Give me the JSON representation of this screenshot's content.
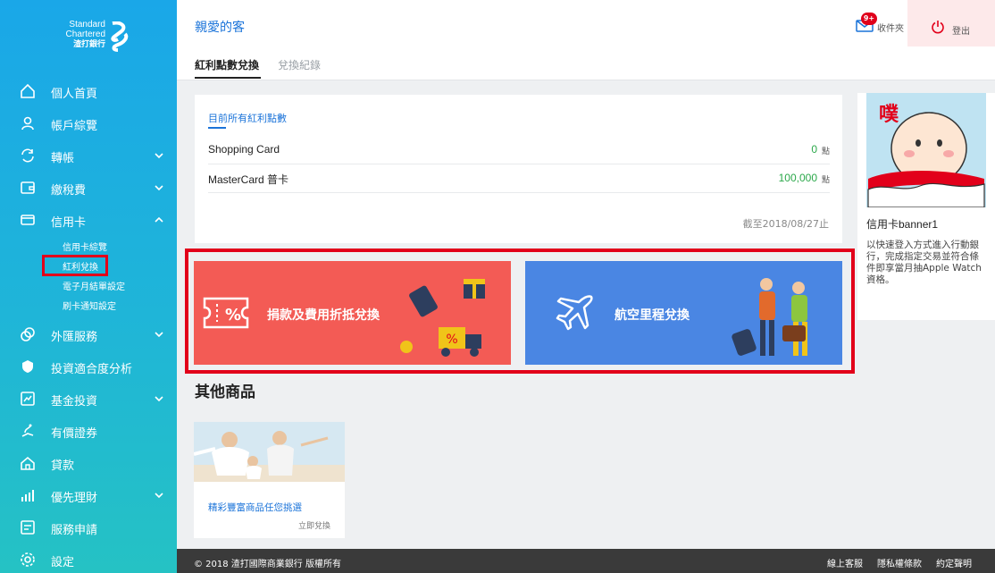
{
  "brand": {
    "line1": "Standard",
    "line2": "Chartered",
    "line3": "渣打銀行"
  },
  "sidebar": {
    "items": [
      {
        "label": "個人首頁",
        "icon": "home-icon"
      },
      {
        "label": "帳戶綜覽",
        "icon": "user-icon"
      },
      {
        "label": "轉帳",
        "icon": "transfer-icon",
        "chevron": "down"
      },
      {
        "label": "繳稅費",
        "icon": "wallet-icon",
        "chevron": "down"
      },
      {
        "label": "信用卡",
        "icon": "credit-card-icon",
        "chevron": "up"
      },
      {
        "label": "外匯服務",
        "icon": "currency-icon",
        "chevron": "down"
      },
      {
        "label": "投資適合度分析",
        "icon": "shield-icon"
      },
      {
        "label": "基金投資",
        "icon": "chart-icon",
        "chevron": "down"
      },
      {
        "label": "有價證券",
        "icon": "securities-icon"
      },
      {
        "label": "貸款",
        "icon": "loan-house-icon"
      },
      {
        "label": "優先理財",
        "icon": "bar-chart-icon",
        "chevron": "down"
      },
      {
        "label": "服務申請",
        "icon": "form-icon"
      },
      {
        "label": "設定",
        "icon": "gear-icon"
      }
    ],
    "credit_sub": [
      "信用卡綜覽",
      "紅利兌換",
      "電子月結單設定",
      "刷卡通知設定"
    ],
    "highlight_color": "#e2001a"
  },
  "header": {
    "greeting": "親愛的客",
    "inbox_label": "收件夾",
    "inbox_badge": "9+",
    "logout_label": "登出"
  },
  "tabs": [
    {
      "label": "紅利點數兌換",
      "active": true
    },
    {
      "label": "兌換紀錄",
      "active": false
    }
  ],
  "points": {
    "title": "目前所有紅利點數",
    "rows": [
      {
        "name": "Shopping Card",
        "value": "0",
        "unit": "點"
      },
      {
        "name": "MasterCard 普卡",
        "value": "100,000",
        "unit": "點"
      }
    ],
    "as_of": "截至2018/08/27止"
  },
  "banners": [
    {
      "label": "捐款及費用折抵兌換",
      "color": "#f35b55",
      "icon": "coupon-icon"
    },
    {
      "label": "航空里程兌換",
      "color": "#4a86e3",
      "icon": "airplane-icon"
    }
  ],
  "promo": {
    "title": "信用卡banner1",
    "desc": "以快速登入方式進入行動銀行，完成指定交易並符合條件即享當月抽Apple Watch資格。",
    "image_text": "噗"
  },
  "other": {
    "heading": "其他商品",
    "product_title": "精彩豐富商品任您挑選",
    "product_link": "立即兌換"
  },
  "footer": {
    "copyright": "© 2018 渣打國際商業銀行 版權所有",
    "links": [
      "線上客服",
      "隱私權條款",
      "約定聲明"
    ]
  }
}
